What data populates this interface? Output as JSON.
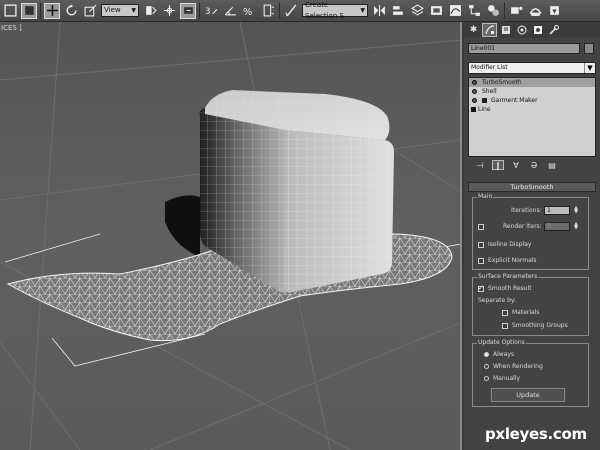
{
  "toolbar": {
    "view_select": "View",
    "selection_set_placeholder": "Create Selection S"
  },
  "viewport": {
    "label": "ICES ]"
  },
  "command_panel": {
    "object_name": "Line001",
    "modifier_list": "Modifier List",
    "stack": [
      {
        "label": "TurboSmooth"
      },
      {
        "label": "Shell"
      },
      {
        "label": "Garment Maker"
      },
      {
        "label": "Line"
      }
    ]
  },
  "turbosmooth": {
    "header": "TurboSmooth",
    "main": {
      "title": "Main",
      "iterations_label": "Iterations:",
      "iterations_value": "1",
      "render_iters_label": "Render Iters:",
      "render_iters_value": "0",
      "isoline_label": "Isoline Display",
      "explicit_normals_label": "Explicit Normals"
    },
    "surface": {
      "title": "Surface Parameters",
      "smooth_result_label": "Smooth Result",
      "separate_by_label": "Separate by:",
      "materials_label": "Materials",
      "smoothing_groups_label": "Smoothing Groups"
    },
    "update": {
      "title": "Update Options",
      "always_label": "Always",
      "when_rendering_label": "When Rendering",
      "manually_label": "Manually",
      "update_button": "Update"
    }
  },
  "watermark": "pxleyes.com"
}
